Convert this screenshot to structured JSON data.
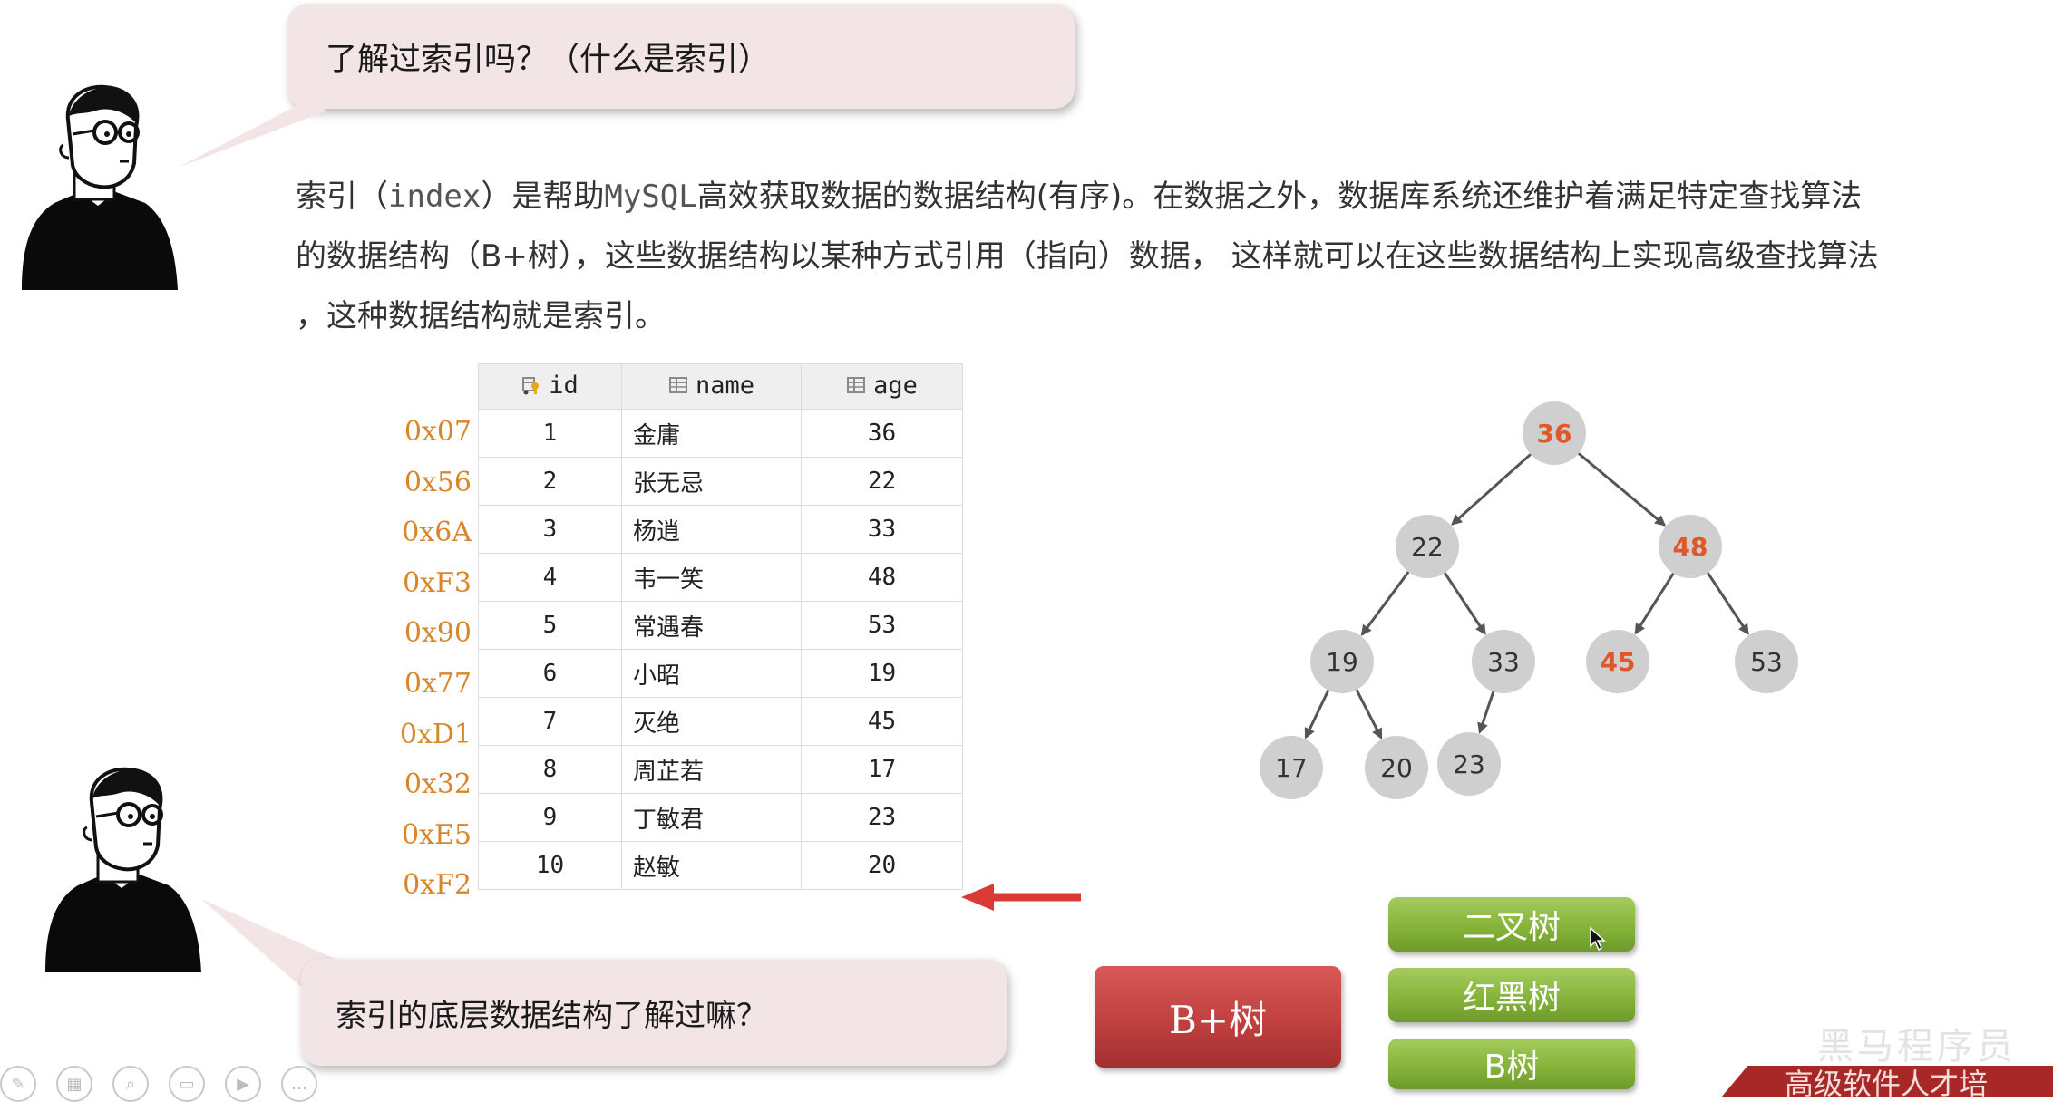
{
  "question_top": "了解过索引吗？（什么是索引）",
  "question_bottom": "索引的底层数据结构了解过嘛？",
  "description": {
    "line1_a": "索引（",
    "line1_b": "index",
    "line1_c": "）是帮助",
    "line1_d": "MySQL",
    "line1_e": "高效获取数据的数据结构(有序)。在数据之外，数据库系统还维护着满足特定查找算法",
    "line2": "的数据结构（B+树），这些数据结构以某种方式引用（指向）数据，  这样就可以在这些数据结构上实现高级查找算法",
    "line3": "，这种数据结构就是索引。"
  },
  "table": {
    "headers": [
      "id",
      "name",
      "age"
    ],
    "header_icons": [
      "key-column-icon",
      "column-icon",
      "column-icon"
    ],
    "rows": [
      {
        "addr": "0x07",
        "id": "1",
        "name": "金庸",
        "age": "36"
      },
      {
        "addr": "0x56",
        "id": "2",
        "name": "张无忌",
        "age": "22"
      },
      {
        "addr": "0x6A",
        "id": "3",
        "name": "杨逍",
        "age": "33"
      },
      {
        "addr": "0xF3",
        "id": "4",
        "name": "韦一笑",
        "age": "48"
      },
      {
        "addr": "0x90",
        "id": "5",
        "name": "常遇春",
        "age": "53"
      },
      {
        "addr": "0x77",
        "id": "6",
        "name": "小昭",
        "age": "19"
      },
      {
        "addr": "0xD1",
        "id": "7",
        "name": "灭绝",
        "age": "45"
      },
      {
        "addr": "0x32",
        "id": "8",
        "name": "周芷若",
        "age": "17"
      },
      {
        "addr": "0xE5",
        "id": "9",
        "name": "丁敏君",
        "age": "23"
      },
      {
        "addr": "0xF2",
        "id": "10",
        "name": "赵敏",
        "age": "20"
      }
    ]
  },
  "tree": {
    "nodes": [
      {
        "id": "n36",
        "label": "36",
        "highlight": true
      },
      {
        "id": "n22",
        "label": "22",
        "highlight": false
      },
      {
        "id": "n48",
        "label": "48",
        "highlight": true
      },
      {
        "id": "n19",
        "label": "19",
        "highlight": false
      },
      {
        "id": "n33",
        "label": "33",
        "highlight": false
      },
      {
        "id": "n45",
        "label": "45",
        "highlight": true
      },
      {
        "id": "n53",
        "label": "53",
        "highlight": false
      },
      {
        "id": "n17",
        "label": "17",
        "highlight": false
      },
      {
        "id": "n20",
        "label": "20",
        "highlight": false
      },
      {
        "id": "n23",
        "label": "23",
        "highlight": false
      }
    ],
    "edges": [
      [
        "n36",
        "n22"
      ],
      [
        "n36",
        "n48"
      ],
      [
        "n22",
        "n19"
      ],
      [
        "n22",
        "n33"
      ],
      [
        "n48",
        "n45"
      ],
      [
        "n48",
        "n53"
      ],
      [
        "n19",
        "n17"
      ],
      [
        "n19",
        "n20"
      ],
      [
        "n33",
        "n23"
      ]
    ],
    "highlight_color": "#e0572a",
    "node_fill": "#cfcfcf",
    "text_color": "#333333"
  },
  "buttons": {
    "binary_tree": "二叉树",
    "red_black_tree": "红黑树",
    "b_tree": "B树",
    "b_plus_tree": "B+树"
  },
  "watermark": "黑马程序员",
  "banner": "高级软件人才培"
}
